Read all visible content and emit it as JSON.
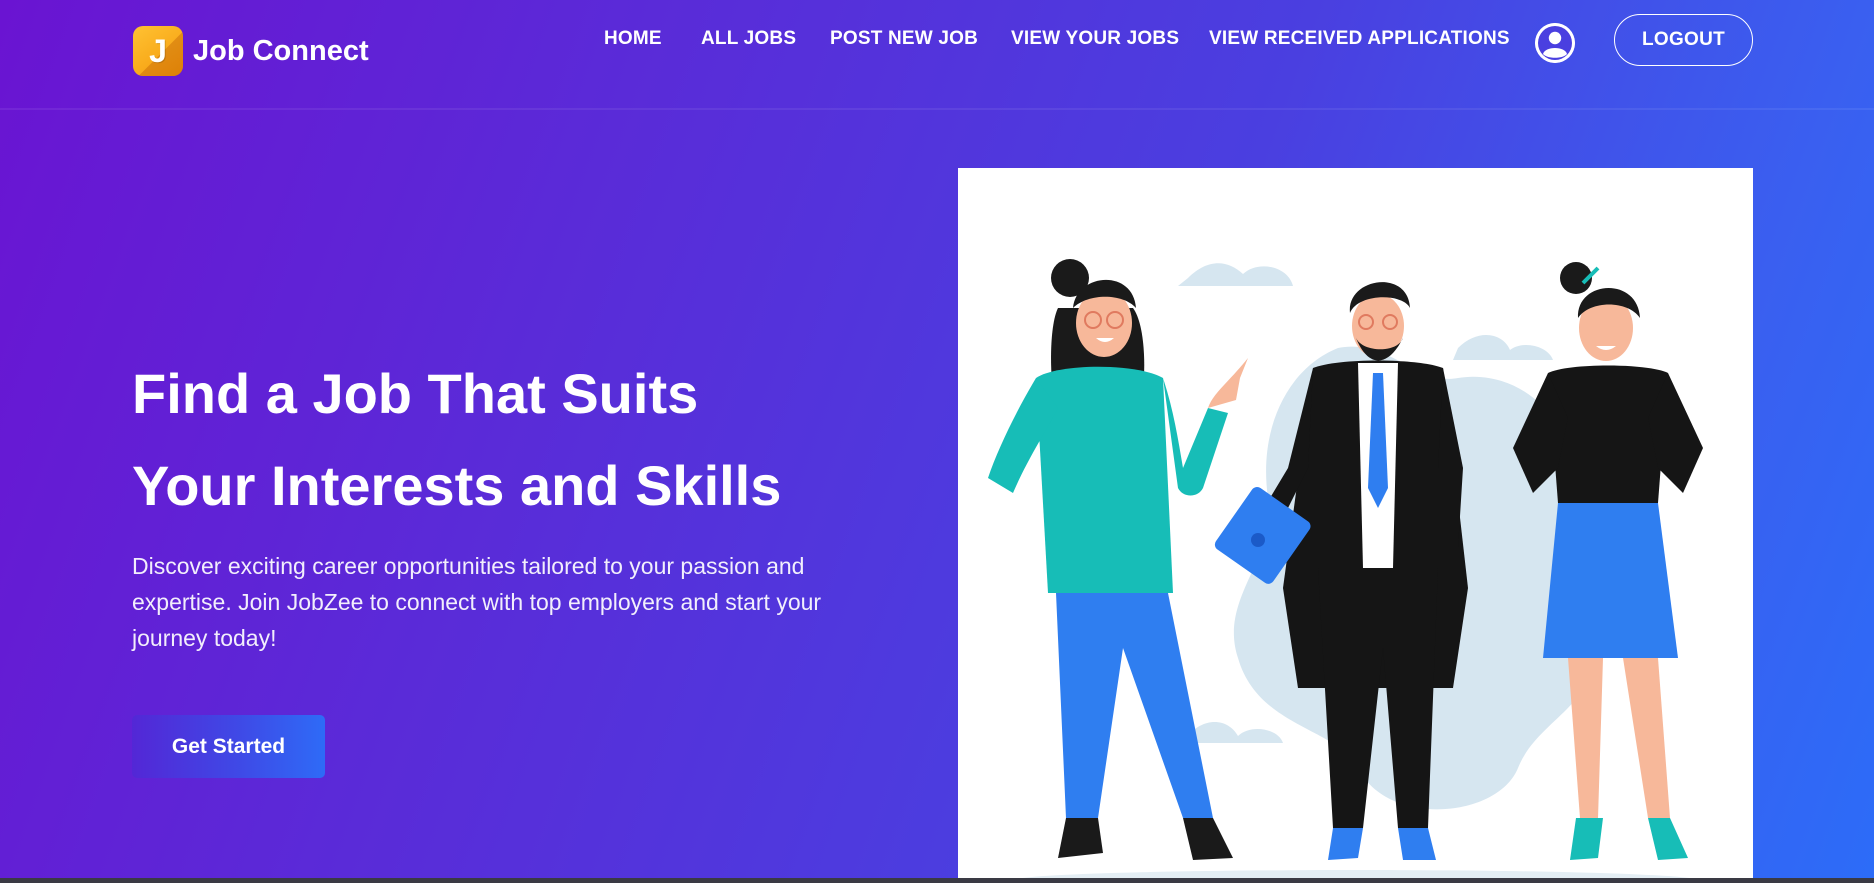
{
  "brand": {
    "logo_letter": "J",
    "name": "Job Connect"
  },
  "nav": {
    "items": [
      {
        "label": "HOME"
      },
      {
        "label": "ALL JOBS"
      },
      {
        "label": "POST NEW JOB"
      },
      {
        "label": "VIEW YOUR JOBS"
      },
      {
        "label": "VIEW RECEIVED APPLICATIONS"
      }
    ],
    "profile_icon": "user-circle-icon",
    "logout_label": "LOGOUT"
  },
  "hero": {
    "title_line1": "Find a Job That Suits",
    "title_line2": "Your Interests and Skills",
    "description": "Discover exciting career opportunities tailored to your passion and expertise. Join JobZee to connect with top employers and start your journey today!",
    "cta_label": "Get Started",
    "illustration": "three-professionals-illustration"
  },
  "colors": {
    "gradient_start": "#6a14d2",
    "gradient_end": "#2c6cf8",
    "logo_accent": "#f9a81a",
    "illustration_bg": "#ffffff"
  }
}
